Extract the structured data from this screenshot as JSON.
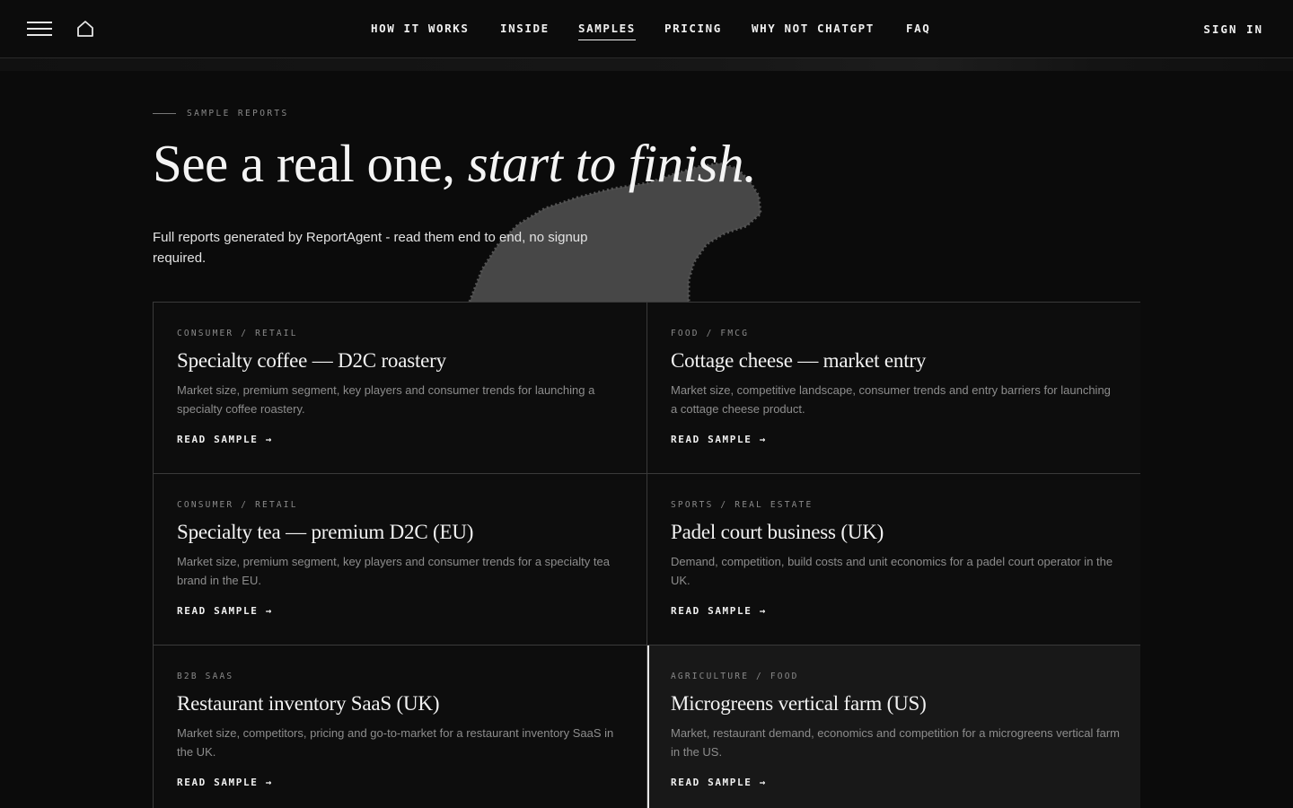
{
  "header": {
    "nav": [
      {
        "label": "HOW IT WORKS",
        "active": false
      },
      {
        "label": "INSIDE",
        "active": false
      },
      {
        "label": "SAMPLES",
        "active": true
      },
      {
        "label": "PRICING",
        "active": false
      },
      {
        "label": "WHY NOT CHATGPT",
        "active": false
      },
      {
        "label": "FAQ",
        "active": false
      }
    ],
    "signin_label": "SIGN IN",
    "menu_icon": "hamburger-menu-icon",
    "home_icon": "home-icon"
  },
  "hero": {
    "eyebrow": "SAMPLE REPORTS",
    "title_plain": "See a real one, ",
    "title_italic": "start to finish.",
    "subtitle": "Full reports generated by ReportAgent - read them end to end, no signup required."
  },
  "samples": [
    {
      "category": "CONSUMER / RETAIL",
      "title": "Specialty coffee — D2C roastery",
      "description": "Market size, premium segment, key players and consumer trends for launching a specialty coffee roastery.",
      "cta": "READ SAMPLE →"
    },
    {
      "category": "FOOD / FMCG",
      "title": "Cottage cheese — market entry",
      "description": "Market size, competitive landscape, consumer trends and entry barriers for launching a cottage cheese product.",
      "cta": "READ SAMPLE →"
    },
    {
      "category": "CONSUMER / RETAIL",
      "title": "Specialty tea — premium D2C (EU)",
      "description": "Market size, premium segment, key players and consumer trends for a specialty tea brand in the EU.",
      "cta": "READ SAMPLE →"
    },
    {
      "category": "SPORTS / REAL ESTATE",
      "title": "Padel court business (UK)",
      "description": "Demand, competition, build costs and unit economics for a padel court operator in the UK.",
      "cta": "READ SAMPLE →"
    },
    {
      "category": "B2B SAAS",
      "title": "Restaurant inventory SaaS (UK)",
      "description": "Market size, competitors, pricing and go-to-market for a restaurant inventory SaaS in the UK.",
      "cta": "READ SAMPLE →"
    },
    {
      "category": "AGRICULTURE / FOOD",
      "title": "Microgreens vertical farm (US)",
      "description": "Market, restaurant demand, economics and competition for a microgreens vertical farm in the US.",
      "cta": "READ SAMPLE →"
    }
  ],
  "colors": {
    "background": "#0b0b0b",
    "text": "#f0f0f0",
    "muted": "#8d8d8d",
    "border": "#3a3a3a"
  }
}
